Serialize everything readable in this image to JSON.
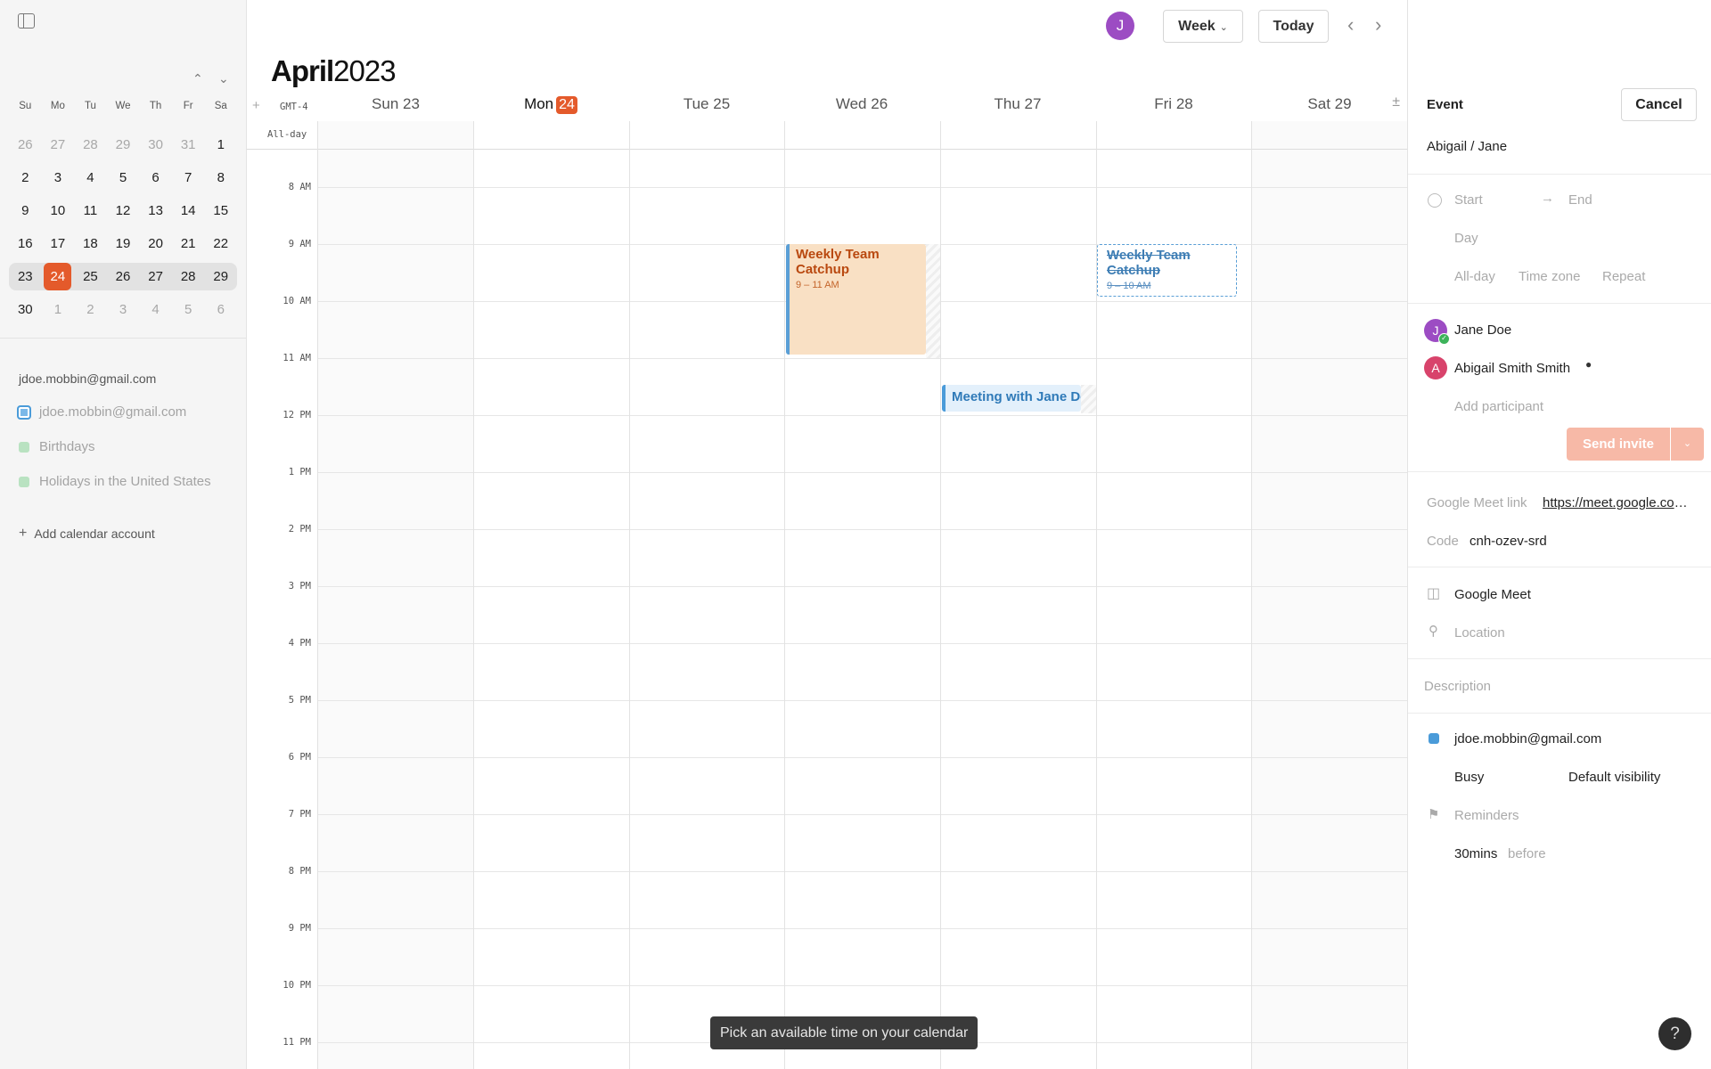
{
  "header": {
    "month": "April",
    "year": "2023",
    "user_initial": "J",
    "view_label": "Week",
    "today_label": "Today"
  },
  "mini_calendar": {
    "weekdays": [
      "Su",
      "Mo",
      "Tu",
      "We",
      "Th",
      "Fr",
      "Sa"
    ],
    "weeks": [
      [
        "26",
        "27",
        "28",
        "29",
        "30",
        "31",
        "1"
      ],
      [
        "2",
        "3",
        "4",
        "5",
        "6",
        "7",
        "8"
      ],
      [
        "9",
        "10",
        "11",
        "12",
        "13",
        "14",
        "15"
      ],
      [
        "16",
        "17",
        "18",
        "19",
        "20",
        "21",
        "22"
      ],
      [
        "23",
        "24",
        "25",
        "26",
        "27",
        "28",
        "29"
      ],
      [
        "30",
        "1",
        "2",
        "3",
        "4",
        "5",
        "6"
      ]
    ]
  },
  "sidebar": {
    "account_title": "jdoe.mobbin@gmail.com",
    "calendars": [
      "jdoe.mobbin@gmail.com",
      "Birthdays",
      "Holidays in the United States"
    ],
    "add_account": "Add calendar account"
  },
  "week": {
    "timezone": "GMT-4",
    "allday_label": "All-day",
    "days": [
      {
        "name": "Sun",
        "num": "23"
      },
      {
        "name": "Mon",
        "num": "24"
      },
      {
        "name": "Tue",
        "num": "25"
      },
      {
        "name": "Wed",
        "num": "26"
      },
      {
        "name": "Thu",
        "num": "27"
      },
      {
        "name": "Fri",
        "num": "28"
      },
      {
        "name": "Sat",
        "num": "29"
      }
    ],
    "hours": [
      "8 AM",
      "9 AM",
      "10 AM",
      "11 AM",
      "12 PM",
      "1 PM",
      "2 PM",
      "3 PM",
      "4 PM",
      "5 PM",
      "6 PM",
      "7 PM",
      "8 PM",
      "9 PM",
      "10 PM",
      "11 PM"
    ],
    "plus_minus": "±"
  },
  "events": {
    "wed": {
      "title": "Weekly Team Catchup",
      "time": "9 – 11 AM"
    },
    "fri": {
      "title": "Weekly Team Catchup",
      "time": "9 – 10 AM"
    },
    "thu": {
      "title": "Meeting with Jane Doe"
    }
  },
  "toast": "Pick an available time on your calendar",
  "panel": {
    "event_label": "Event",
    "cancel": "Cancel",
    "title": "Abigail / Jane",
    "start_placeholder": "Start",
    "end_placeholder": "End",
    "day_placeholder": "Day",
    "allday": "All-day",
    "timezone": "Time zone",
    "repeat": "Repeat",
    "participants": [
      {
        "initial": "J",
        "name": "Jane Doe",
        "color": "#9c4cc3"
      },
      {
        "initial": "A",
        "name": "Abigail Smith Smith",
        "color": "#d8436b"
      }
    ],
    "add_participant": "Add participant",
    "send_invite": "Send invite",
    "meet_link_label": "Google Meet link",
    "meet_link": "https://meet.google.com/cnh-ozev-srd",
    "code_label": "Code",
    "code": "cnh-ozev-srd",
    "conferencing": "Google Meet",
    "location_placeholder": "Location",
    "description_placeholder": "Description",
    "calendar": "jdoe.mobbin@gmail.com",
    "busy": "Busy",
    "visibility": "Default visibility",
    "reminders_label": "Reminders",
    "reminder_value": "30mins",
    "reminder_suffix": "before"
  },
  "colors": {
    "accent": "#e45a2b",
    "event_orange": "#f9e0c4",
    "event_blue": "#4a9bd9"
  }
}
